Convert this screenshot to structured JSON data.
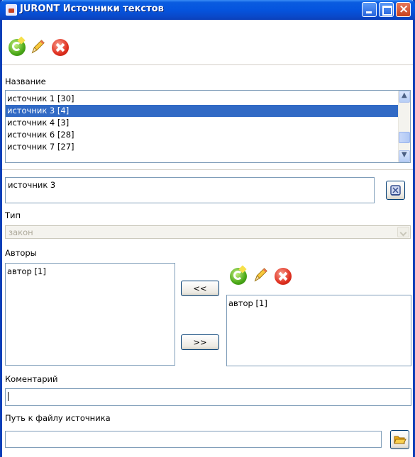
{
  "window": {
    "title": "JURONT Источники текстов",
    "controls": {
      "minimize": "minimize",
      "maximize": "maximize",
      "close": "close"
    }
  },
  "toolbar": {
    "icons": [
      "add-icon",
      "edit-icon",
      "delete-icon"
    ]
  },
  "sources": {
    "label": "Название",
    "items": [
      {
        "label": "источник 1 [30]",
        "selected": false
      },
      {
        "label": "источник 3 [4]",
        "selected": true
      },
      {
        "label": "источник 4 [3]",
        "selected": false
      },
      {
        "label": "источник 6 [28]",
        "selected": false
      },
      {
        "label": "источник 7 [27]",
        "selected": false
      }
    ]
  },
  "name_field": {
    "value": "источник 3"
  },
  "type": {
    "label": "Тип",
    "value": "закон"
  },
  "authors": {
    "label": "Авторы",
    "left_items": [
      "автор [1]"
    ],
    "right_items": [
      "автор [1]"
    ],
    "move_left_label": "<<",
    "move_right_label": ">>"
  },
  "comment": {
    "label": "Коментарий",
    "value": ""
  },
  "file_path": {
    "label": "Путь к файлу источника",
    "value": ""
  },
  "colors": {
    "selection": "#316ac5",
    "titlebar": "#0554de",
    "border": "#7f9db9"
  }
}
